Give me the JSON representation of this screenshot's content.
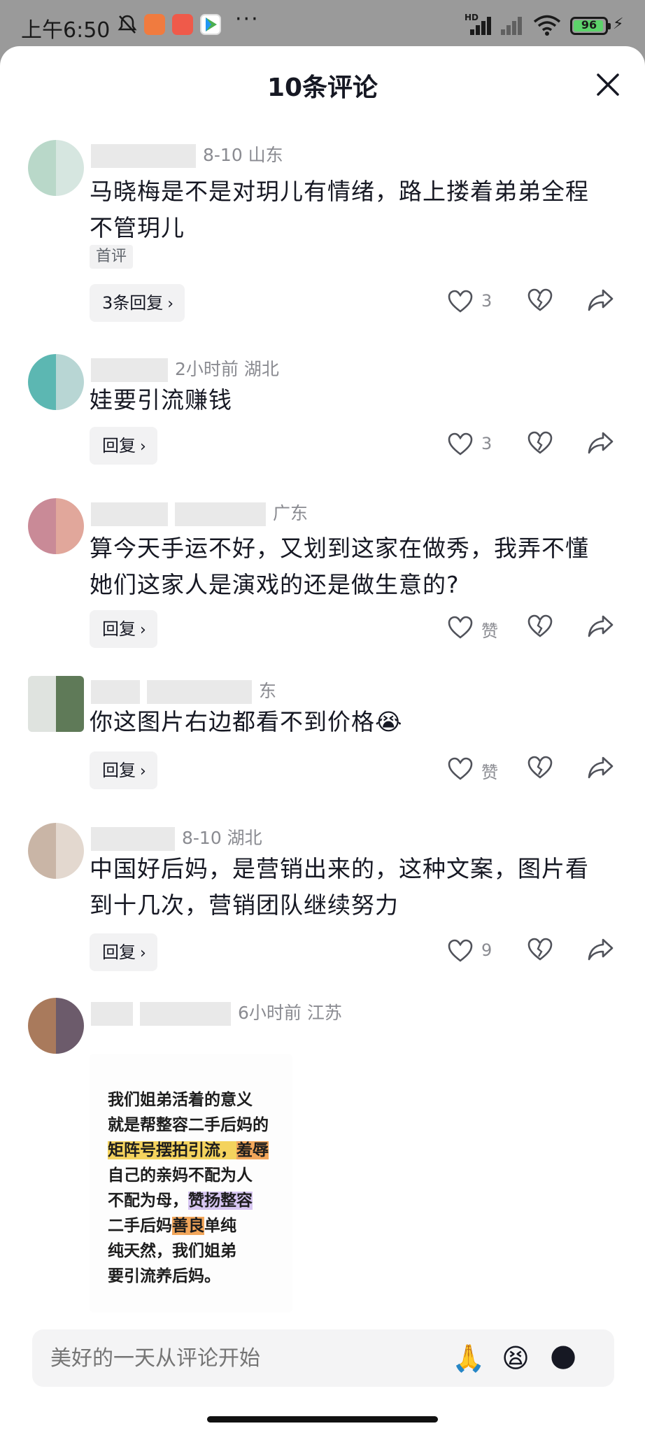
{
  "status_bar": {
    "time": "上午6:50",
    "battery": "96",
    "battery_level": 0.96,
    "network": "HD"
  },
  "sheet": {
    "title": "10条评论",
    "close_icon": "close-icon"
  },
  "comments": [
    {
      "meta_tail": "8-10 山东",
      "text": "马晓梅是不是对玥儿有情绪，路上搂着弟弟全程不管玥儿",
      "tag": "首评",
      "reply_label": "3条回复",
      "likes": "3"
    },
    {
      "meta_tail": "2小时前 湖北",
      "text": "娃要引流赚钱",
      "reply_label": "回复",
      "likes": "3"
    },
    {
      "meta_tail": "广东",
      "text": "算今天手运不好，又划到这家在做秀，我弄不懂她们这家人是演戏的还是做生意的?",
      "reply_label": "回复",
      "likes": "赞"
    },
    {
      "meta_tail": "东",
      "text": "你这图片右边都看不到价格😭",
      "reply_label": "回复",
      "likes": "赞"
    },
    {
      "meta_tail": "8-10 湖北",
      "text": "中国好后妈，是营销出来的，这种文案，图片看到十几次，营销团队继续努力",
      "reply_label": "回复",
      "likes": "9"
    },
    {
      "meta_tail": "6小时前 江苏"
    }
  ],
  "image_text": {
    "line1": "我们姐弟活着的意义",
    "line2": "就是帮整容二手后妈的",
    "line3a": "矩阵号摆拍引流，",
    "line3b": "羞辱",
    "line4": "自己的亲妈不配为人",
    "line5a": "不配为母，",
    "line5b": "赞扬整容",
    "line6a": "二手后妈",
    "line6b": "善良",
    "line6c": "单纯",
    "line7": "纯天然，我们姐弟",
    "line8": "要引流养后妈。"
  },
  "input": {
    "placeholder": "美好的一天从评论开始",
    "emoji_1": "🙏",
    "emoji_2": "😫",
    "emoji_3": "🌑"
  },
  "colors": {
    "accent_highlight_yellow": "#f4d35e",
    "accent_highlight_orange": "#f2a65a",
    "accent_highlight_purple": "#d7c6f2",
    "text_primary": "#161823",
    "text_secondary": "#8a8b91"
  }
}
